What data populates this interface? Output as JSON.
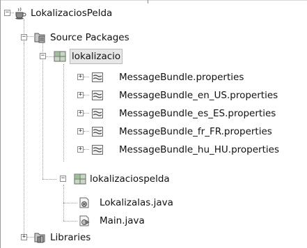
{
  "project_tree": {
    "project": {
      "label": "LokalizaciosPelda",
      "icon": "coffee-cup-project-icon",
      "expanded": true
    },
    "source_packages": {
      "label": "Source Packages",
      "icon": "source-folder-icon",
      "expanded": true
    },
    "packages": [
      {
        "label": "lokalizacio",
        "icon": "package-icon",
        "expanded": true,
        "selected": true,
        "files": [
          {
            "label": "MessageBundle.properties",
            "icon": "properties-file-icon"
          },
          {
            "label": "MessageBundle_en_US.properties",
            "icon": "properties-file-icon"
          },
          {
            "label": "MessageBundle_es_ES.properties",
            "icon": "properties-file-icon"
          },
          {
            "label": "MessageBundle_fr_FR.properties",
            "icon": "properties-file-icon"
          },
          {
            "label": "MessageBundle_hu_HU.properties",
            "icon": "properties-file-icon"
          }
        ]
      },
      {
        "label": "lokalizaciospelda",
        "icon": "package-icon",
        "expanded": true,
        "selected": false,
        "files": [
          {
            "label": "Lokalizalas.java",
            "icon": "java-class-icon"
          },
          {
            "label": "Main.java",
            "icon": "java-main-class-icon"
          }
        ]
      }
    ],
    "libraries": {
      "label": "Libraries",
      "icon": "libraries-icon",
      "expanded": false
    }
  },
  "colors": {
    "selection_background": "#e7e7e7",
    "tree_line": "#9a9a9a",
    "package_green": "#8fb58a"
  }
}
